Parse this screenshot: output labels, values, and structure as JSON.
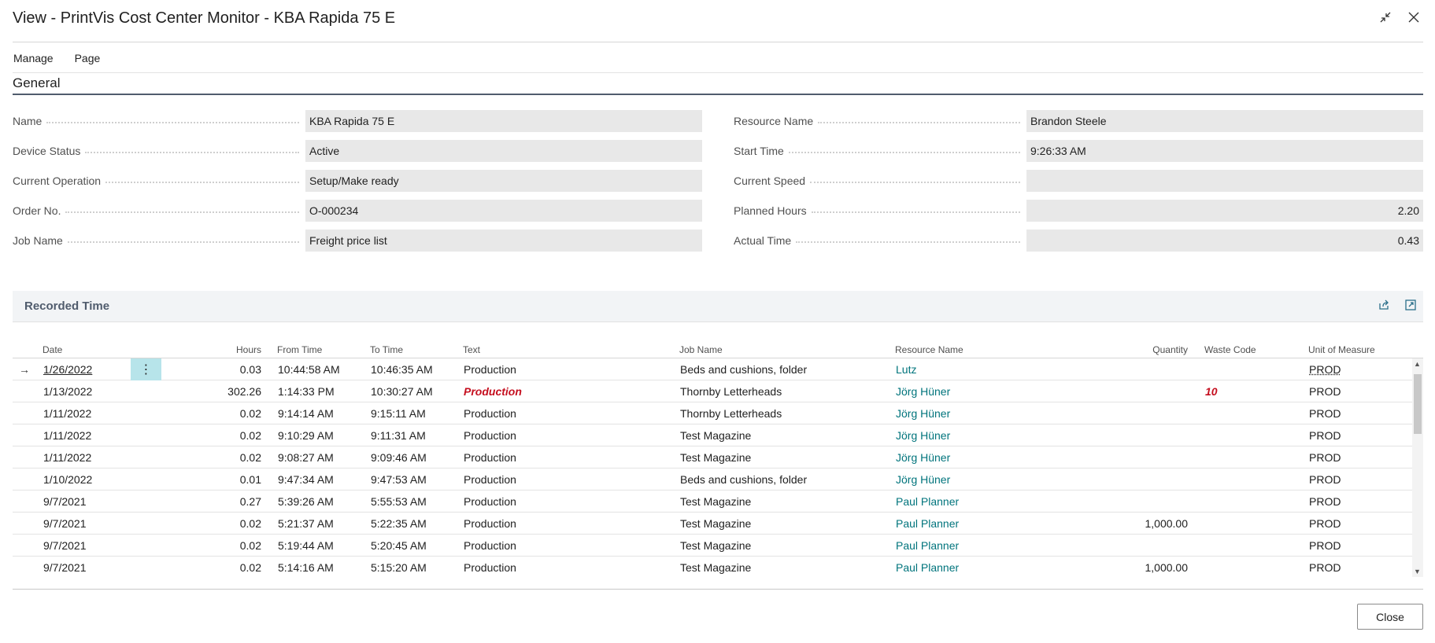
{
  "window": {
    "title": "View - PrintVis Cost Center Monitor - KBA Rapida 75 E",
    "collapse_icon": "collapse-arrows-icon",
    "close_icon": "close-icon"
  },
  "menu": {
    "items": [
      "Manage",
      "Page"
    ]
  },
  "general": {
    "title": "General",
    "left": [
      {
        "label": "Name",
        "value": "KBA Rapida 75 E"
      },
      {
        "label": "Device Status",
        "value": "Active"
      },
      {
        "label": "Current Operation",
        "value": "Setup/Make ready"
      },
      {
        "label": "Order No.",
        "value": "O-000234"
      },
      {
        "label": "Job Name",
        "value": "Freight price list"
      }
    ],
    "right": [
      {
        "label": "Resource Name",
        "value": "Brandon Steele"
      },
      {
        "label": "Start Time",
        "value": "9:26:33 AM"
      },
      {
        "label": "Current Speed",
        "value": ""
      },
      {
        "label": "Planned Hours",
        "value": "2.20"
      },
      {
        "label": "Actual Time",
        "value": "0.43"
      }
    ]
  },
  "recorded_time": {
    "title": "Recorded Time",
    "icons": [
      "share-icon",
      "expand-icon"
    ],
    "columns": {
      "date": "Date",
      "hours": "Hours",
      "from": "From Time",
      "to": "To Time",
      "text": "Text",
      "job": "Job Name",
      "resource": "Resource Name",
      "qty": "Quantity",
      "waste": "Waste Code",
      "uom": "Unit of Measure"
    },
    "rows": [
      {
        "date": "1/26/2022",
        "hours": "0.03",
        "from": "10:44:58 AM",
        "to": "10:46:35 AM",
        "text": "Production",
        "job": "Beds and cushions, folder",
        "resource": "Lutz",
        "qty": "",
        "waste": "",
        "uom": "PROD"
      },
      {
        "date": "1/13/2022",
        "hours": "302.26",
        "from": "1:14:33 PM",
        "to": "10:30:27 AM",
        "text": "Production",
        "job": "Thornby Letterheads",
        "resource": "Jörg Hüner",
        "qty": "",
        "waste": "10",
        "uom": "PROD"
      },
      {
        "date": "1/11/2022",
        "hours": "0.02",
        "from": "9:14:14 AM",
        "to": "9:15:11 AM",
        "text": "Production",
        "job": "Thornby Letterheads",
        "resource": "Jörg Hüner",
        "qty": "",
        "waste": "",
        "uom": "PROD"
      },
      {
        "date": "1/11/2022",
        "hours": "0.02",
        "from": "9:10:29 AM",
        "to": "9:11:31 AM",
        "text": "Production",
        "job": "Test Magazine",
        "resource": "Jörg Hüner",
        "qty": "",
        "waste": "",
        "uom": "PROD"
      },
      {
        "date": "1/11/2022",
        "hours": "0.02",
        "from": "9:08:27 AM",
        "to": "9:09:46 AM",
        "text": "Production",
        "job": "Test Magazine",
        "resource": "Jörg Hüner",
        "qty": "",
        "waste": "",
        "uom": "PROD"
      },
      {
        "date": "1/10/2022",
        "hours": "0.01",
        "from": "9:47:34 AM",
        "to": "9:47:53 AM",
        "text": "Production",
        "job": "Beds and cushions, folder",
        "resource": "Jörg Hüner",
        "qty": "",
        "waste": "",
        "uom": "PROD"
      },
      {
        "date": "9/7/2021",
        "hours": "0.27",
        "from": "5:39:26 AM",
        "to": "5:55:53 AM",
        "text": "Production",
        "job": "Test Magazine",
        "resource": "Paul Planner",
        "qty": "",
        "waste": "",
        "uom": "PROD"
      },
      {
        "date": "9/7/2021",
        "hours": "0.02",
        "from": "5:21:37 AM",
        "to": "5:22:35 AM",
        "text": "Production",
        "job": "Test Magazine",
        "resource": "Paul Planner",
        "qty": "1,000.00",
        "waste": "",
        "uom": "PROD"
      },
      {
        "date": "9/7/2021",
        "hours": "0.02",
        "from": "5:19:44 AM",
        "to": "5:20:45 AM",
        "text": "Production",
        "job": "Test Magazine",
        "resource": "Paul Planner",
        "qty": "",
        "waste": "",
        "uom": "PROD"
      },
      {
        "date": "9/7/2021",
        "hours": "0.02",
        "from": "5:14:16 AM",
        "to": "5:15:20 AM",
        "text": "Production",
        "job": "Test Magazine",
        "resource": "Paul Planner",
        "qty": "1,000.00",
        "waste": "",
        "uom": "PROD"
      }
    ]
  },
  "footer": {
    "close_label": "Close"
  }
}
